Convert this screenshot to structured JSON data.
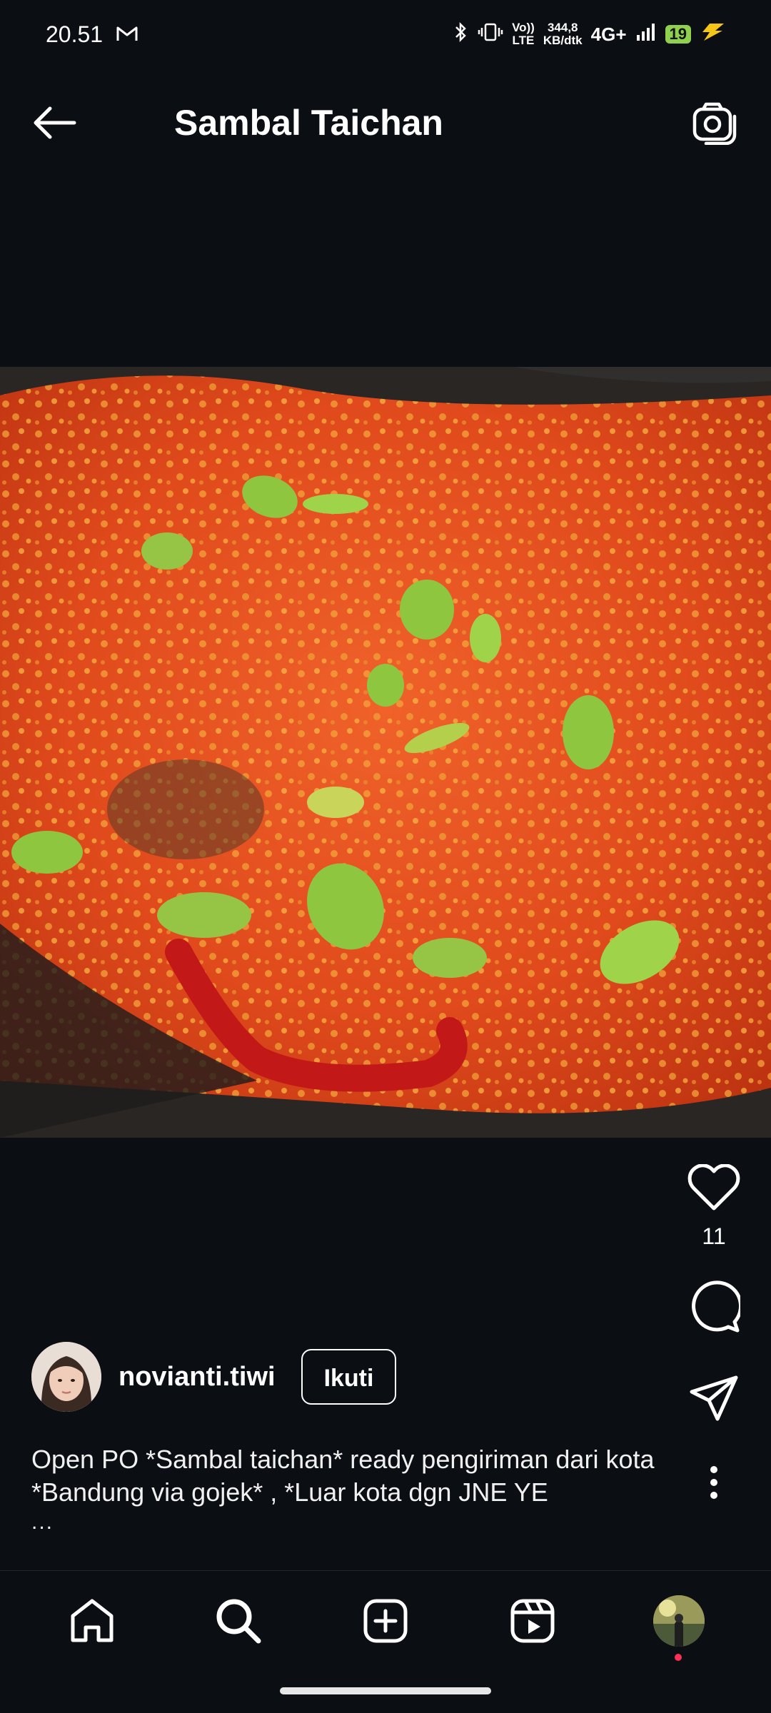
{
  "status_bar": {
    "time": "20.51",
    "network_speed_value": "344,8",
    "network_speed_unit": "KB/dtk",
    "volte_top": "Vo))",
    "volte_bottom": "LTE",
    "network_type": "4G+",
    "battery": "19"
  },
  "header": {
    "title": "Sambal Taichan"
  },
  "actions": {
    "like_count": "11"
  },
  "author": {
    "username": "novianti.tiwi",
    "follow_label": "Ikuti"
  },
  "caption": {
    "text": "Open PO *Sambal taichan* ready pengiriman dari kota *Bandung via gojek* , *Luar kota dgn JNE YE",
    "more": "..."
  },
  "icons": {
    "gmail": "gmail-icon",
    "bluetooth": "bluetooth-icon",
    "vibrate": "vibrate-icon",
    "signal": "signal-icon",
    "charging": "charging-icon",
    "back": "back-arrow-icon",
    "camera": "camera-icon",
    "heart": "heart-icon",
    "comment": "comment-icon",
    "share": "share-icon",
    "more": "more-vertical-icon",
    "home": "home-icon",
    "search": "search-icon",
    "create": "create-icon",
    "reels": "reels-icon"
  },
  "colors": {
    "background": "#0b0e13",
    "text": "#ffffff",
    "battery": "#8fd14f",
    "notification": "#ff2f55",
    "sambal": "#d8431c",
    "petai": "#8ec640"
  }
}
